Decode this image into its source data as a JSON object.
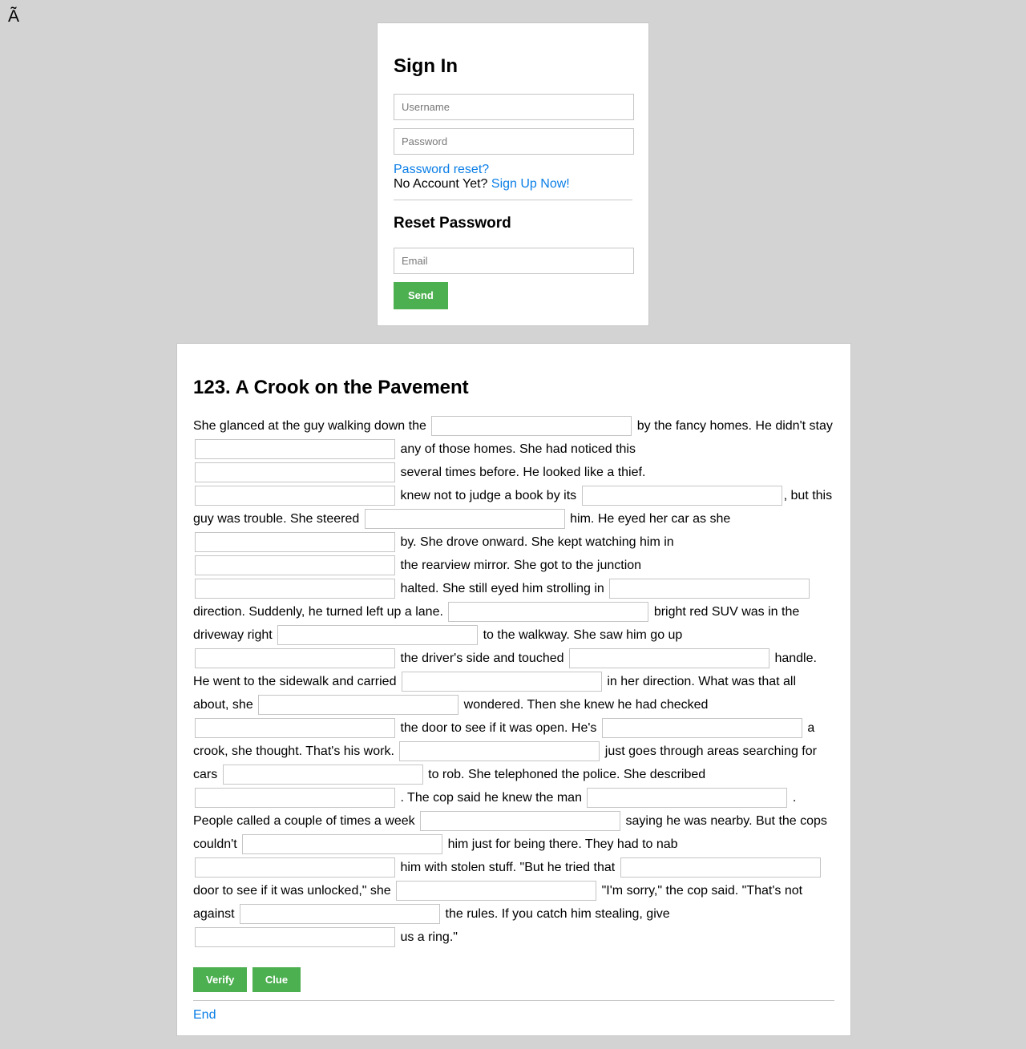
{
  "corner_glyph": "Ã",
  "login": {
    "title": "Sign In",
    "username_placeholder": "Username",
    "password_placeholder": "Password",
    "reset_link": "Password reset?",
    "no_account_text": "No Account Yet?",
    "signup_link": "Sign Up Now!",
    "reset_title": "Reset Password",
    "email_placeholder": "Email",
    "send_label": "Send"
  },
  "story": {
    "title": "123. A Crook on the Pavement",
    "segments": [
      "She glanced at the guy walking down the",
      "by the fancy homes. He didn't stay",
      "any of those homes. She had noticed this",
      "several times before. He looked like a thief.",
      "knew not to judge a book by its",
      ", but this guy was trouble. She steered",
      "him. He eyed her car as she",
      "by. She drove onward. She kept watching him in",
      "the rearview mirror. She got to the junction",
      "halted. She still eyed him strolling in",
      "direction. Suddenly, he turned left up a lane.",
      "bright red SUV was in the driveway right",
      "to the walkway. She saw him go up",
      "the driver's side and touched",
      "handle. He went to the sidewalk and carried",
      "in her direction. What was that all about, she",
      "wondered. Then she knew he had checked",
      "the door to see if it was open. He's",
      "a crook, she thought. That's his work.",
      "just goes through areas searching for cars",
      "to rob. She telephoned the police. She described",
      ". The cop said he knew the man",
      ". People called a couple of times a week",
      "saying he was nearby. But the cops couldn't",
      "him just for being there. They had to nab",
      "him with stolen stuff. \"But he tried that",
      "door to see if it was unlocked,\" she",
      "\"I'm sorry,\" the cop said. \"That's not against",
      "the rules. If you catch him stealing, give",
      "us a ring.\""
    ],
    "verify_label": "Verify",
    "clue_label": "Clue",
    "end_link": "End"
  },
  "colors": {
    "page_background": "#d3d3d3",
    "button_green": "#4caf50",
    "link_blue": "#0a7ee6"
  }
}
